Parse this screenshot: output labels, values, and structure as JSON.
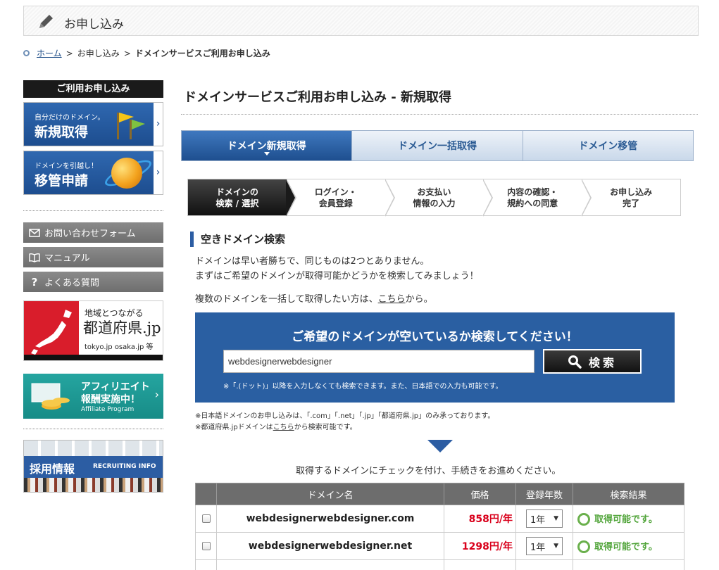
{
  "header": {
    "title": "お申し込み"
  },
  "breadcrumb": {
    "home": "ホーム",
    "sep": ">",
    "level2": "お申し込み",
    "current": "ドメインサービスご利用お申し込み"
  },
  "sidebar": {
    "heading": "ご利用お申し込み",
    "banner_new": {
      "small": "自分だけのドメイン。",
      "big": "新規取得"
    },
    "banner_transfer": {
      "small": "ドメインを引越し！",
      "big": "移管申請"
    },
    "links": [
      {
        "label": "お問い合わせフォーム",
        "icon": "mail-icon"
      },
      {
        "label": "マニュアル",
        "icon": "book-icon"
      },
      {
        "label": "よくある質問",
        "icon": "question-icon"
      }
    ],
    "todofuken": {
      "line1": "地域とつながる",
      "line2": "都道府県.jp",
      "line3": "tokyo.jp osaka.jp 等"
    },
    "affiliate": {
      "line1": "アフィリエイト",
      "line2": "報酬実施中！",
      "line3": "Affiliate Program"
    },
    "recruit": {
      "title": "採用情報",
      "sub": "RECRUITING INFO"
    }
  },
  "main": {
    "title": "ドメインサービスご利用お申し込み - 新規取得",
    "tabs": [
      {
        "label": "ドメイン新規取得"
      },
      {
        "label": "ドメイン一括取得"
      },
      {
        "label": "ドメイン移管"
      }
    ],
    "steps": [
      {
        "l1": "ドメインの",
        "l2": "検索 / 選択"
      },
      {
        "l1": "ログイン・",
        "l2": "会員登録"
      },
      {
        "l1": "お支払い",
        "l2": "情報の入力"
      },
      {
        "l1": "内容の確認・",
        "l2": "規約への同意"
      },
      {
        "l1": "お申し込み",
        "l2": "完了"
      }
    ],
    "section_title": "空きドメイン検索",
    "intro_line1": "ドメインは早い者勝ちで、同じものは2つとありません。",
    "intro_line2": "まずはご希望のドメインが取得可能かどうかを検索してみましょう！",
    "bulk_prefix": "複数のドメインを一括して取得したい方は、",
    "bulk_link": "こちら",
    "bulk_suffix": "から。",
    "search": {
      "heading": "ご希望のドメインが空いているか検索してください！",
      "value": "webdesignerwebdesigner",
      "button": "検索",
      "note": "※「.(ドット)」以降を入力しなくても検索できます。また、日本語での入力も可能です。"
    },
    "note1": "※日本語ドメインのお申し込みは、「.com」「.net」「.jp」「都道府県.jp」のみ承っております。",
    "note2_prefix": "※都道府県.jpドメインは",
    "note2_link": "こちら",
    "note2_suffix": "から検索可能です。",
    "instruction": "取得するドメインにチェックを付け、手続きをお進めください。",
    "table": {
      "headers": [
        "",
        "ドメイン名",
        "価格",
        "登録年数",
        "検索結果"
      ],
      "rows": [
        {
          "domain": "webdesignerwebdesigner.com",
          "price": "858円/年",
          "years": "1年",
          "result": "取得可能です。"
        },
        {
          "domain": "webdesignerwebdesigner.net",
          "price": "1298円/年",
          "years": "1年",
          "result": "取得可能です。"
        }
      ]
    }
  },
  "colors": {
    "brand_blue": "#2a5fa2",
    "price_red": "#d9001b",
    "ok_green": "#52a53b"
  }
}
